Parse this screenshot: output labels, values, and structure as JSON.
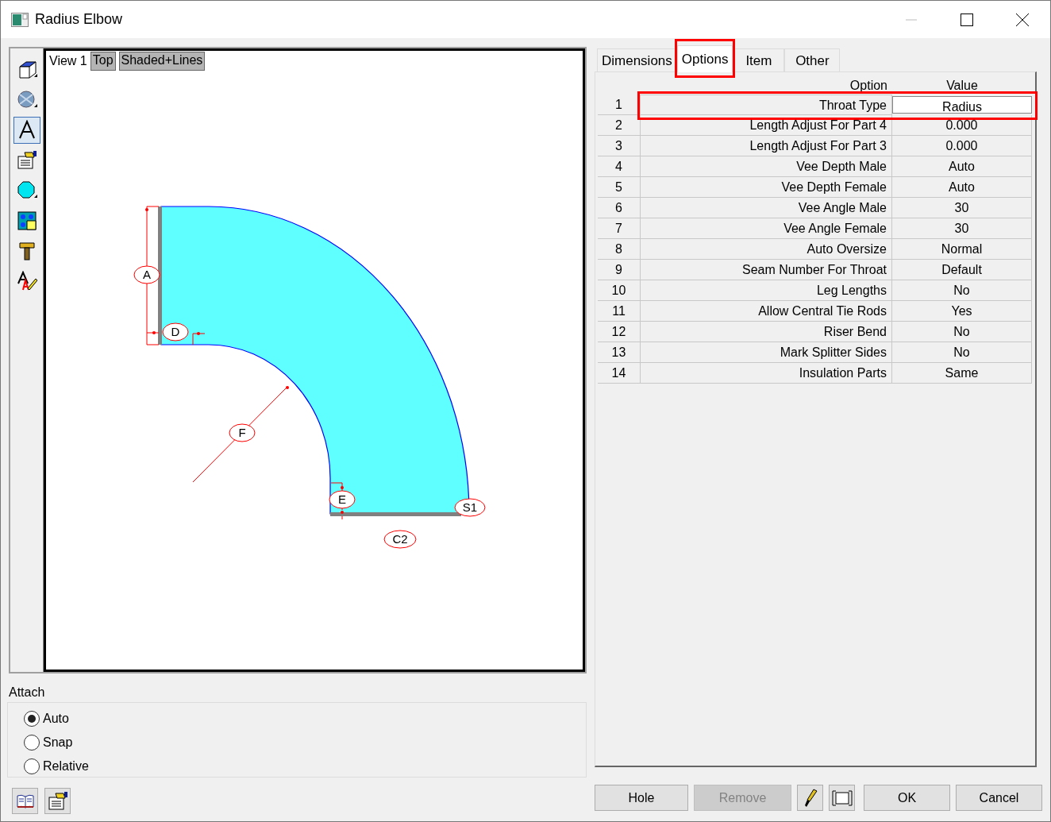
{
  "window": {
    "title": "Radius Elbow"
  },
  "toolbar": {
    "tools": [
      {
        "kind": "cube",
        "selected": false
      },
      {
        "kind": "sphere",
        "selected": false
      },
      {
        "kind": "text",
        "selected": true
      },
      {
        "kind": "properties",
        "selected": false
      },
      {
        "kind": "octagon",
        "selected": false
      },
      {
        "kind": "tiles",
        "selected": false
      },
      {
        "kind": "hammer",
        "selected": false
      },
      {
        "kind": "spelling",
        "selected": false
      }
    ]
  },
  "view": {
    "name": "View 1",
    "buttons": [
      "Top",
      "Shaded+Lines"
    ],
    "dimension_labels": [
      "A",
      "D",
      "F",
      "E",
      "S1",
      "C2"
    ]
  },
  "attach": {
    "label": "Attach",
    "options": [
      {
        "label": "Auto",
        "selected": true
      },
      {
        "label": "Snap",
        "selected": false
      },
      {
        "label": "Relative",
        "selected": false
      }
    ]
  },
  "tabs": [
    {
      "label": "Dimensions",
      "selected": false,
      "highlighted": false
    },
    {
      "label": "Options",
      "selected": true,
      "highlighted": true
    },
    {
      "label": "Item",
      "selected": false,
      "highlighted": false
    },
    {
      "label": "Other",
      "selected": false,
      "highlighted": false
    }
  ],
  "table": {
    "columns": [
      "Option",
      "Value"
    ],
    "rows": [
      {
        "number": "1",
        "option": "Throat Type",
        "value": "Radius",
        "selected": true,
        "highlighted": true
      },
      {
        "number": "2",
        "option": "Length Adjust For Part 4",
        "value": "0.000",
        "selected": false,
        "highlighted": false
      },
      {
        "number": "3",
        "option": "Length Adjust For Part 3",
        "value": "0.000",
        "selected": false,
        "highlighted": false
      },
      {
        "number": "4",
        "option": "Vee Depth Male",
        "value": "Auto",
        "selected": false,
        "highlighted": false
      },
      {
        "number": "5",
        "option": "Vee Depth Female",
        "value": "Auto",
        "selected": false,
        "highlighted": false
      },
      {
        "number": "6",
        "option": "Vee Angle Male",
        "value": "30",
        "selected": false,
        "highlighted": false
      },
      {
        "number": "7",
        "option": "Vee Angle Female",
        "value": "30",
        "selected": false,
        "highlighted": false
      },
      {
        "number": "8",
        "option": "Auto Oversize",
        "value": "Normal",
        "selected": false,
        "highlighted": false
      },
      {
        "number": "9",
        "option": "Seam Number For Throat",
        "value": "Default",
        "selected": false,
        "highlighted": false
      },
      {
        "number": "10",
        "option": "Leg Lengths",
        "value": "No",
        "selected": false,
        "highlighted": false
      },
      {
        "number": "11",
        "option": "Allow Central Tie Rods",
        "value": "Yes",
        "selected": false,
        "highlighted": false
      },
      {
        "number": "12",
        "option": "Riser Bend",
        "value": "No",
        "selected": false,
        "highlighted": false
      },
      {
        "number": "13",
        "option": "Mark Splitter Sides",
        "value": "No",
        "selected": false,
        "highlighted": false
      },
      {
        "number": "14",
        "option": "Insulation Parts",
        "value": "Same",
        "selected": false,
        "highlighted": false
      }
    ]
  },
  "bottom_left_tools": [
    {
      "kind": "book"
    },
    {
      "kind": "properties"
    }
  ],
  "buttons": [
    {
      "kind": "text",
      "label": "Hole",
      "disabled": false
    },
    {
      "kind": "text",
      "label": "Remove",
      "disabled": true
    },
    {
      "kind": "brush"
    },
    {
      "kind": "frame"
    },
    {
      "kind": "text",
      "label": "OK",
      "disabled": false
    },
    {
      "kind": "text",
      "label": "Cancel",
      "disabled": false
    }
  ]
}
